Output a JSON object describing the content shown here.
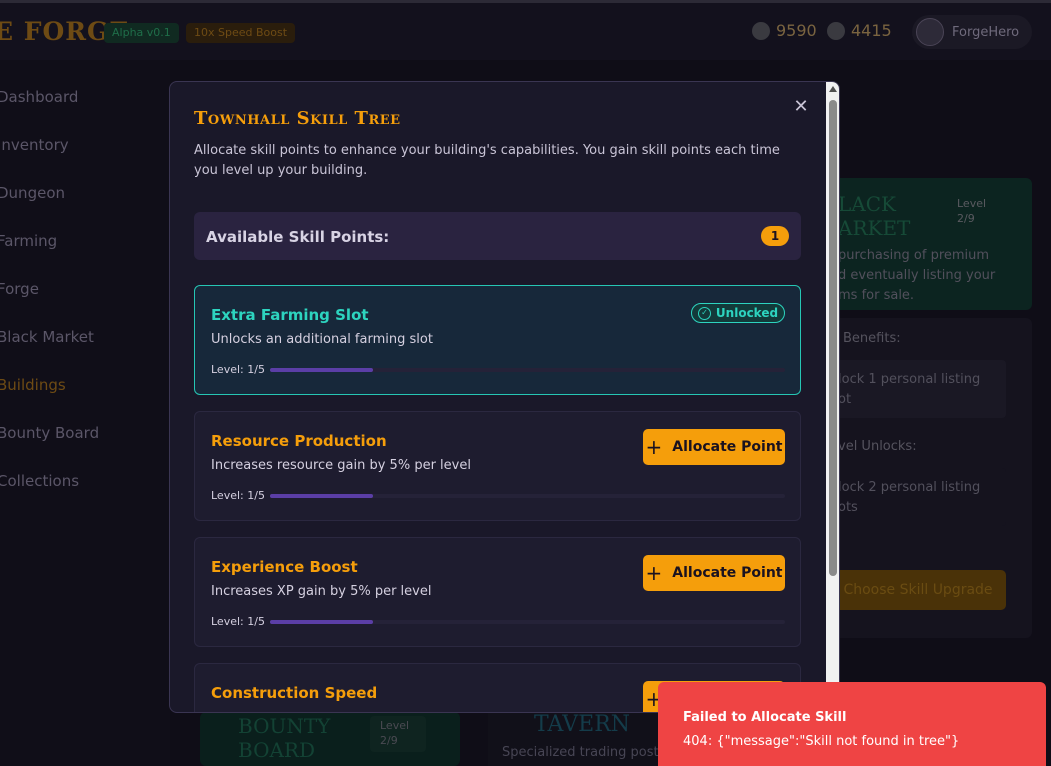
{
  "header": {
    "brand": "E FORGE",
    "alpha_badge": "Alpha v0.1",
    "speed_badge": "10x Speed Boost",
    "currency_1": "9590",
    "currency_2": "4415",
    "username": "ForgeHero"
  },
  "sidebar": {
    "items": [
      {
        "label": "Dashboard"
      },
      {
        "label": "Inventory"
      },
      {
        "label": "Dungeon"
      },
      {
        "label": "Farming"
      },
      {
        "label": "Forge"
      },
      {
        "label": "Black Market"
      },
      {
        "label": "Buildings",
        "active": true
      },
      {
        "label": "Bounty Board"
      },
      {
        "label": "Collections"
      }
    ]
  },
  "background": {
    "black_market_title": "LACK\nARKET",
    "black_market_level": "Level\n2/9",
    "black_market_desc": "purchasing of premium\nd eventually listing your\nms for sale.",
    "benefits_label": "Benefits:",
    "benefit_1": "lock 1 personal listing\not",
    "next_level_label": "vel Unlocks:",
    "next_benefit_1": "lock 2 personal listing\nots",
    "choose_skill_button": "Choose Skill Upgrade",
    "bounty_title": "BOUNTY\nBOARD",
    "bounty_level": "Level\n2/9",
    "tavern_title": "TAVERN",
    "tavern_desc": "Specialized trading post f"
  },
  "modal": {
    "title": "Townhall Skill Tree",
    "description": "Allocate skill points to enhance your building's capabilities. You gain skill points each time you level up your building.",
    "points_label": "Available Skill Points:",
    "points_value": "1",
    "allocate_label": "Allocate Point",
    "skills": [
      {
        "name": "Extra Farming Slot",
        "description": "Unlocks an additional farming slot",
        "level": "Level: 1/5",
        "progress": 0.2,
        "status": "Unlocked"
      },
      {
        "name": "Resource Production",
        "description": "Increases resource gain by 5% per level",
        "level": "Level: 1/5",
        "progress": 0.2
      },
      {
        "name": "Experience Boost",
        "description": "Increases XP gain by 5% per level",
        "level": "Level: 1/5",
        "progress": 0.2
      },
      {
        "name": "Construction Speed"
      }
    ]
  },
  "toast": {
    "title": "Failed to Allocate Skill",
    "message": "404: {\"message\":\"Skill not found in tree\"}"
  },
  "colors": {
    "accent": "#f59e0b",
    "teal": "#2dd4bf",
    "progress": "#5b3ea6",
    "error": "#ef4444"
  }
}
